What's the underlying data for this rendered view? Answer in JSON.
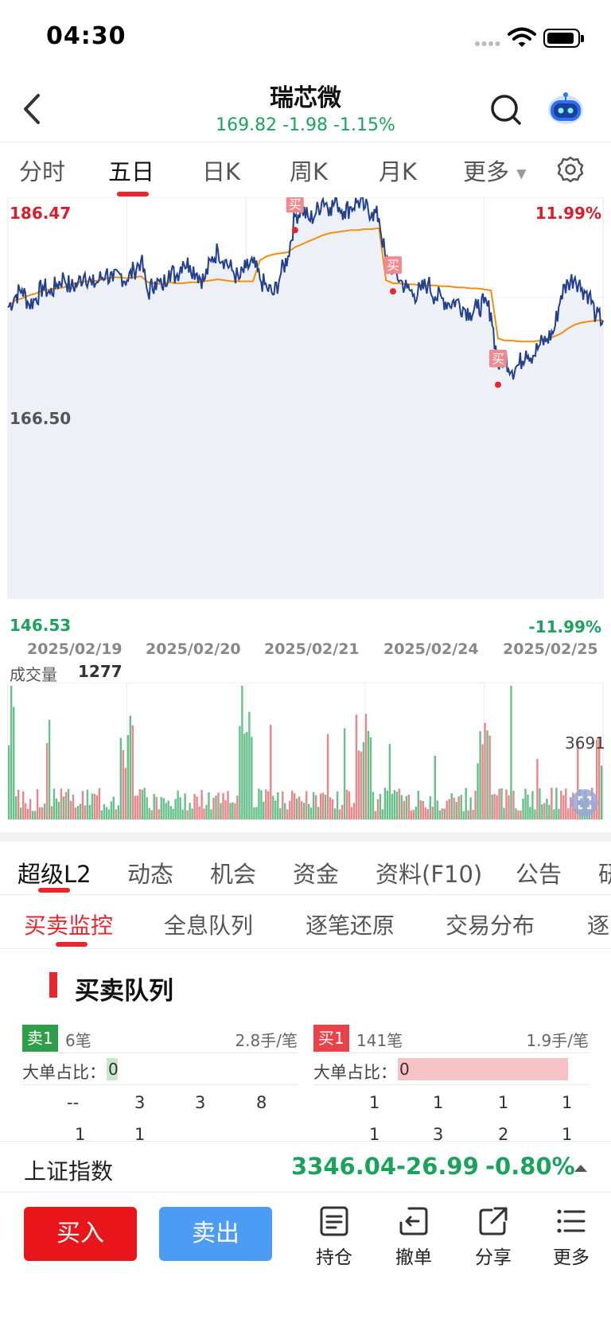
{
  "status_bar": {
    "time": "04:30"
  },
  "header": {
    "title": "瑞芯微",
    "quote": "169.82 -1.98 -1.15%"
  },
  "period_tabs": [
    {
      "label": "分时"
    },
    {
      "label": "五日"
    },
    {
      "label": "日K"
    },
    {
      "label": "周K"
    },
    {
      "label": "月K"
    },
    {
      "label": "更多"
    }
  ],
  "active_period_tab": "五日",
  "colors": {
    "price_line": "#23408e",
    "avg_line": "#f0900c",
    "up": "#e8262d",
    "down": "#1aa35c",
    "buy_marker": "#e8262d"
  },
  "chart_data": {
    "type": "line",
    "ylim": [
      146.53,
      186.47
    ],
    "y_labels": {
      "top": "186.47",
      "mid": "166.50",
      "bottom": "146.53",
      "top_pct": "11.99%",
      "bottom_pct": "-11.99%"
    },
    "dates": [
      "2025/02/19",
      "2025/02/20",
      "2025/02/21",
      "2025/02/24",
      "2025/02/25"
    ],
    "buy_marker_label": "买",
    "series": [
      {
        "values": [
          175.5,
          176.6,
          177.3,
          175.8,
          176.4,
          177.6,
          176.9,
          177.8,
          178.5,
          177.4,
          177.9,
          178.9,
          177.7,
          178.2,
          179.0,
          178.1,
          178.8,
          178.2,
          179.2,
          180.2,
          176.9,
          178.1,
          177.5,
          179.2,
          178.6,
          180.1,
          179.7,
          178.9,
          178.2,
          180.1,
          181.2,
          180.2,
          179.2,
          178.3,
          179.4,
          179.9,
          178.3,
          177.4,
          176.8,
          178.9,
          180.6,
          184.6,
          185.4,
          184.2,
          184.9,
          186.3,
          185.5,
          186.0,
          185.1,
          185.5,
          186.1,
          185.4,
          185.0,
          184.4,
          180.0,
          179.5,
          178.2,
          177.4,
          176.8,
          177.2,
          177.9,
          176.6,
          176.4,
          175.9,
          176.2,
          175.5,
          175.0,
          175.4,
          175.9,
          175.0,
          169.6,
          170.6,
          169.2,
          169.8,
          171.2,
          170.7,
          171.8,
          172.3,
          173.2,
          176.7,
          178.0,
          178.5,
          177.4,
          176.8,
          174.6,
          174.2
        ]
      },
      {
        "values": [
          175.5,
          176.2,
          176.4,
          176.7,
          176.9,
          177.2,
          177.3,
          177.4,
          177.5,
          177.8,
          178.0,
          178.1,
          178.1,
          178.2,
          178.4,
          178.5,
          178.5,
          178.4,
          178.5,
          178.6,
          178.0,
          177.9,
          177.8,
          178.0,
          177.9,
          177.9,
          178.0,
          178.0,
          178.1,
          178.2,
          178.3,
          178.2,
          178.1,
          178.1,
          178.1,
          178.1,
          180.2,
          180.6,
          180.8,
          180.9,
          181.0,
          181.5,
          181.8,
          182.1,
          182.4,
          182.7,
          182.9,
          183.0,
          183.1,
          183.2,
          183.2,
          183.3,
          183.3,
          183.4,
          178.2,
          177.9,
          177.9,
          177.8,
          177.8,
          177.7,
          177.7,
          177.7,
          177.6,
          177.6,
          177.5,
          177.5,
          177.4,
          177.4,
          177.3,
          177.2,
          172.4,
          172.2,
          172.2,
          172.1,
          172.1,
          172.1,
          172.2,
          172.4,
          172.6,
          172.9,
          173.4,
          173.8,
          174.0,
          174.1,
          174.2,
          174.2
        ]
      }
    ],
    "buy_points": [
      {
        "x_index": 41,
        "y": 183.2
      },
      {
        "x_index": 55,
        "y": 177.1
      },
      {
        "x_index": 70,
        "y": 167.8
      }
    ],
    "volume": {
      "label": "成交量",
      "current": "1277",
      "max_label": "3691"
    }
  },
  "section_tabs": [
    {
      "label": "超级L2"
    },
    {
      "label": "动态"
    },
    {
      "label": "机会"
    },
    {
      "label": "资金"
    },
    {
      "label": "资料(F10)"
    },
    {
      "label": "公告"
    },
    {
      "label": "研"
    }
  ],
  "sub_tabs": [
    {
      "label": "买卖监控"
    },
    {
      "label": "全息队列"
    },
    {
      "label": "逐笔还原"
    },
    {
      "label": "交易分布"
    },
    {
      "label": "逐"
    }
  ],
  "queue": {
    "title": "买卖队列",
    "sell": {
      "tag": "卖1",
      "count": "6笔",
      "avg": "2.8手/笔",
      "ratio_label": "大单占比：",
      "ratio": "0",
      "rows": [
        [
          "--",
          "3",
          "3",
          "8"
        ],
        [
          "1",
          "1",
          "",
          ""
        ]
      ]
    },
    "buy": {
      "tag": "买1",
      "count": "141笔",
      "avg": "1.9手/笔",
      "ratio_label": "大单占比：",
      "ratio": "0",
      "rows": [
        [
          "1",
          "1",
          "1",
          "1"
        ],
        [
          "1",
          "3",
          "2",
          "1"
        ]
      ]
    }
  },
  "index": {
    "name": "上证指数",
    "value": "3346.04",
    "change": "-26.99",
    "pct": "-0.80%"
  },
  "actions": {
    "buy": "买入",
    "sell": "卖出",
    "tools": [
      {
        "label": "持仓"
      },
      {
        "label": "撤单"
      },
      {
        "label": "分享"
      },
      {
        "label": "更多"
      }
    ]
  }
}
